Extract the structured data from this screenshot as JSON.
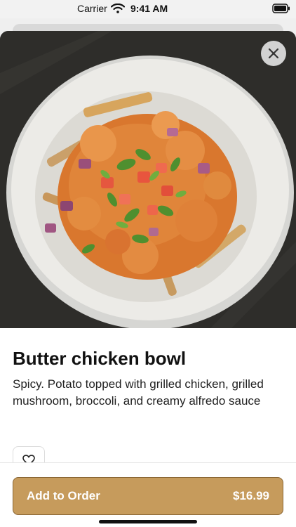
{
  "status_bar": {
    "carrier": "Carrier",
    "time": "9:41 AM"
  },
  "item": {
    "name": "Butter chicken bowl",
    "description": "Spicy. Potato topped with grilled chicken, grilled mushroom, broccoli, and creamy alfredo sauce",
    "image_icon": "food-photo"
  },
  "actions": {
    "close_icon": "close-icon",
    "favorite_icon": "heart-icon",
    "add_to_order_label": "Add to Order",
    "price": "$16.99"
  },
  "colors": {
    "accent": "#c69b5c",
    "accent_border": "#8a6634",
    "photo_background": "#2e2d2a"
  }
}
